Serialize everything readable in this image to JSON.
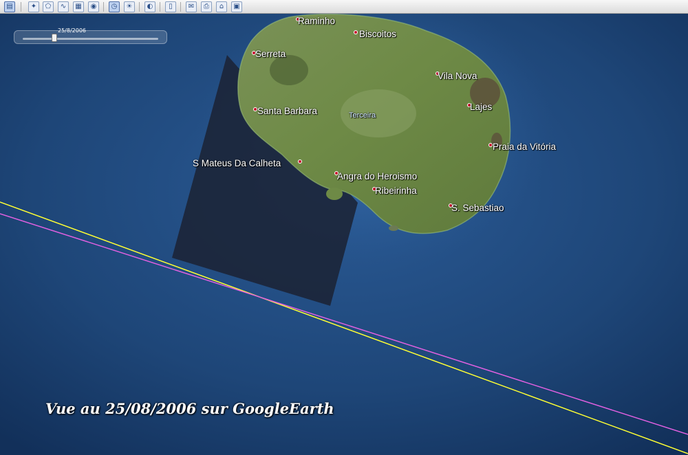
{
  "toolbar": {
    "buttons": [
      {
        "name": "sidebar-toggle-button",
        "icon": "sidebar-icon",
        "glyph": "▤"
      },
      {
        "name": "add-placemark-button",
        "icon": "placemark-icon",
        "glyph": "✦"
      },
      {
        "name": "add-polygon-button",
        "icon": "polygon-icon",
        "glyph": "⬠"
      },
      {
        "name": "add-path-button",
        "icon": "path-icon",
        "glyph": "∿"
      },
      {
        "name": "add-image-overlay-button",
        "icon": "image-overlay-icon",
        "glyph": "▦"
      },
      {
        "name": "record-tour-button",
        "icon": "tour-icon",
        "glyph": "◉"
      },
      {
        "name": "historical-imagery-button",
        "icon": "clock-icon",
        "glyph": "◷"
      },
      {
        "name": "sunlight-button",
        "icon": "sun-icon",
        "glyph": "☀"
      },
      {
        "name": "switch-planet-button",
        "icon": "planet-icon",
        "glyph": "◐"
      },
      {
        "name": "ruler-button",
        "icon": "ruler-icon",
        "glyph": "▯"
      },
      {
        "name": "email-button",
        "icon": "email-icon",
        "glyph": "✉"
      },
      {
        "name": "print-button",
        "icon": "print-icon",
        "glyph": "⎙"
      },
      {
        "name": "view-in-maps-button",
        "icon": "maps-icon",
        "glyph": "⌂"
      },
      {
        "name": "save-image-button",
        "icon": "save-image-icon",
        "glyph": "▣"
      }
    ]
  },
  "time_slider": {
    "date": "25/8/2006",
    "position": 0.2
  },
  "places": [
    {
      "name": "Raminho"
    },
    {
      "name": "Biscoitos"
    },
    {
      "name": "Serreta"
    },
    {
      "name": "Vila Nova"
    },
    {
      "name": "Lajes"
    },
    {
      "name": "Santa Barbara"
    },
    {
      "name": "Terceira"
    },
    {
      "name": "Praia da Vitória"
    },
    {
      "name": "S Mateus Da Calheta"
    },
    {
      "name": "Angra do Heroismo"
    },
    {
      "name": "Ribeirinha"
    },
    {
      "name": "S. Sebastiao"
    }
  ],
  "caption": "Vue au 25/08/2006 sur GoogleEarth",
  "colors": {
    "ocean": "#1d3f6e",
    "yellow_line": "#ffff33",
    "magenta_line": "#e060e0",
    "land": "#6f8a4a",
    "overlay": "#1b2336"
  }
}
